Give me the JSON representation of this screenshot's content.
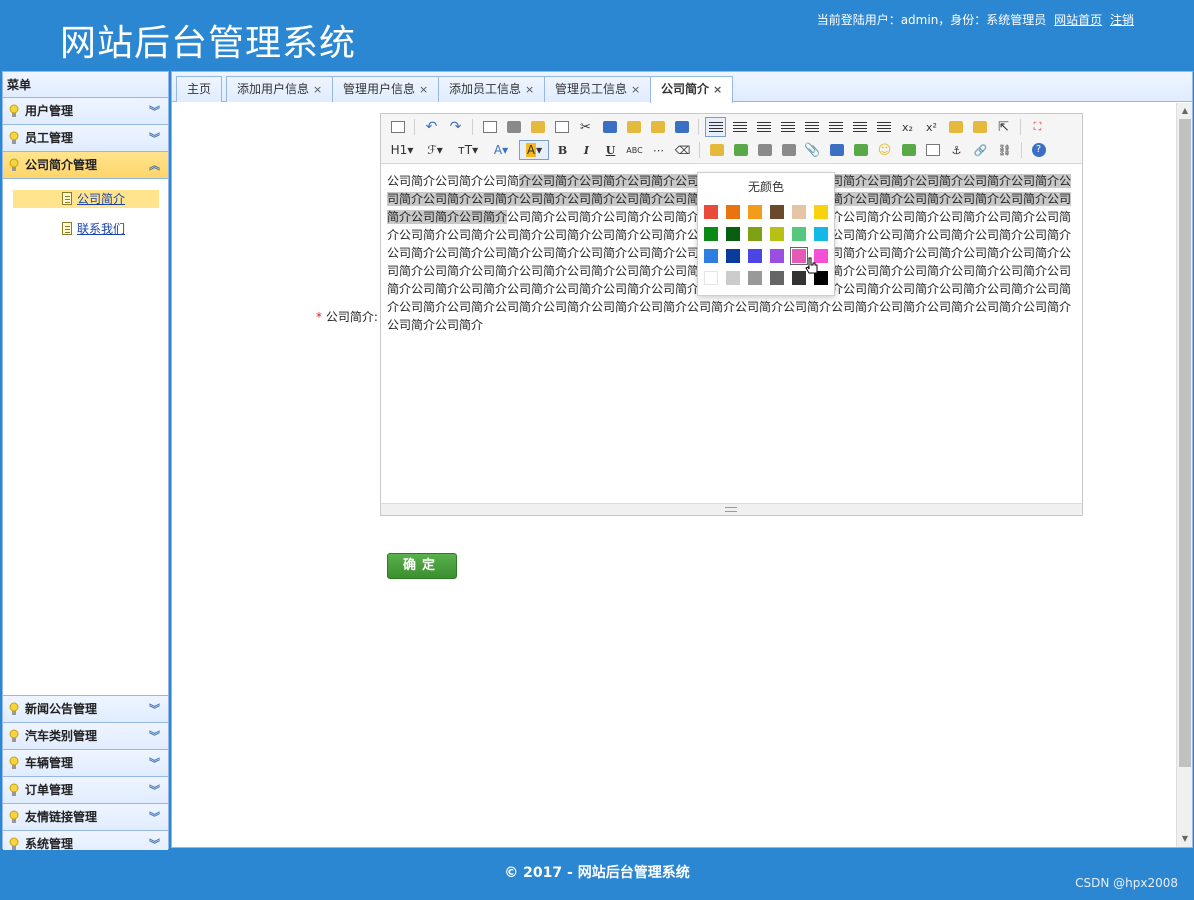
{
  "header": {
    "brand": "网站后台管理系统",
    "user_text": "当前登陆用户：admin，身份：系统管理员",
    "home_link": "网站首页",
    "logout_link": "注销"
  },
  "sidebar": {
    "title": "菜单",
    "groups_top": [
      {
        "label": "用户管理"
      },
      {
        "label": "员工管理"
      },
      {
        "label": "公司简介管理"
      }
    ],
    "sub_items": [
      {
        "label": "公司简介"
      },
      {
        "label": "联系我们"
      }
    ],
    "groups_bottom": [
      {
        "label": "新闻公告管理"
      },
      {
        "label": "汽车类别管理"
      },
      {
        "label": "车辆管理"
      },
      {
        "label": "订单管理"
      },
      {
        "label": "友情链接管理"
      },
      {
        "label": "系统管理"
      }
    ]
  },
  "tabs": [
    {
      "label": "主页"
    },
    {
      "label": "添加用户信息"
    },
    {
      "label": "管理用户信息"
    },
    {
      "label": "添加员工信息"
    },
    {
      "label": "管理员工信息"
    },
    {
      "label": "公司简介"
    }
  ],
  "form": {
    "required_mark": "*",
    "label": "公司简介:",
    "confirm_label": "确定"
  },
  "editor": {
    "text_plain_1": "公司简介公司简介公司简",
    "text_highlight": "介公司简介公司简介公司简介公司简介公司简介公司简介公司简介公司简介公司简介公司简介公司简介公司简介公司简介公司简介公司简介公司简介公司简介公司简介公司简介公司简介公司简介公司简介公司简介公司简介公司简介公司简介公司简介公司简介",
    "text_plain_2": "公司简介公司简介公司简介公司简介公司简介公司简介公司简介公司简介公司简介公司简介公司简介公司简介公司简介公司简介公司简介公司简介公司简介公司简介公司简介公司简介公司简介公司简介公司简介公司简介公司简介公司简介公司简介公司简介公司简介公司简介公司简介公司简介公司简介公司简介公司简介公司简介公司简介公司简介公司简介公司简介公司简介公司简介公司简介公司简介公司简介公司简介公司简介公司简介公司简介公司简介公司简介公司简介公司简介公司简介公司简介公司简介公司简介公司简介公司简介公司简介公司简介公司简介公司简介公司简介公司简介公司简介公司简介公司简介公司简介公司简介公司简介公司简介公司简介公司简介公司简介公司简介公司简介公司简介公司简介公司简介公司简介公司简介公司简介公司简介公司简介",
    "toolbar": {
      "heading": "H1",
      "bold": "B",
      "italic": "I",
      "underline": "U",
      "strike": "ABC",
      "font_size": "тT",
      "font_color": "A",
      "bg_color": "A",
      "sub": "x₂",
      "sup": "x²"
    },
    "picker": {
      "no_color": "无颜色",
      "colors": [
        "#e84b3c",
        "#e8730f",
        "#f39c1a",
        "#6b4a2b",
        "#e4c5a6",
        "#f7d30f",
        "#0a8a14",
        "#085f12",
        "#7fa214",
        "#b6c114",
        "#57c67e",
        "#12b9e6",
        "#2e7ee0",
        "#0a3c9c",
        "#4b45e3",
        "#9b4fe0",
        "#e55ab7",
        "#f54fd7",
        "#ffffff",
        "#cccccc",
        "#999999",
        "#666666",
        "#333333",
        "#000000"
      ]
    }
  },
  "footer": {
    "copyright": "© 2017 - 网站后台管理系统",
    "watermark": "CSDN @hpx2008"
  }
}
